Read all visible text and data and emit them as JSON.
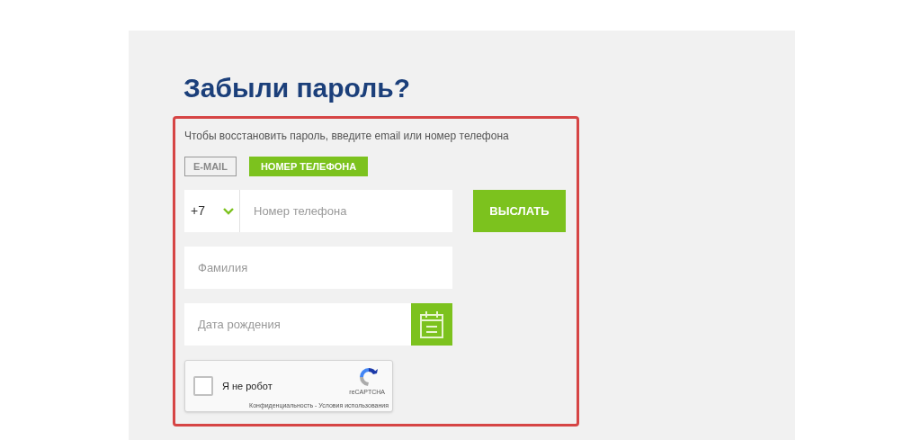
{
  "title": "Забыли пароль?",
  "hint": "Чтобы восстановить пароль, введите email или номер телефона",
  "tabs": [
    {
      "label": "E-MAIL",
      "selected": false
    },
    {
      "label": "НОМЕР ТЕЛЕФОНА",
      "selected": true
    }
  ],
  "phone": {
    "code": "+7",
    "placeholder": "Номер телефона"
  },
  "send_button": "ВЫСЛАТЬ",
  "surname": {
    "placeholder": "Фамилия"
  },
  "birth_date": {
    "placeholder": "Дата рождения"
  },
  "captcha": {
    "label": "Я не робот",
    "checked": false,
    "brand": "reCAPTCHA",
    "links": "Конфиденциальность - Условия использования"
  }
}
